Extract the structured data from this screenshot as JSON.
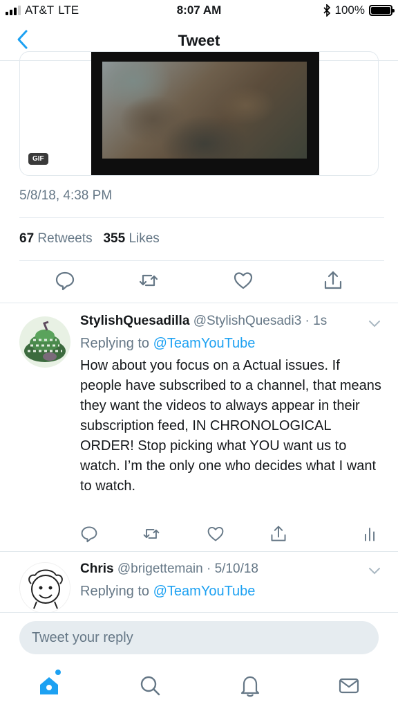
{
  "status_bar": {
    "carrier": "AT&T",
    "network": "LTE",
    "time": "8:07 AM",
    "battery": "100%",
    "battery_level": 1.0
  },
  "nav": {
    "title": "Tweet",
    "back_icon": "chevron-left-icon"
  },
  "tweet": {
    "media_badge": "GIF",
    "timestamp": "5/8/18, 4:38 PM",
    "retweets_count": "67",
    "retweets_label": "Retweets",
    "likes_count": "355",
    "likes_label": "Likes",
    "actions": [
      "reply-icon",
      "retweet-icon",
      "like-icon",
      "share-icon"
    ]
  },
  "replies": [
    {
      "name": "StylishQuesadilla",
      "handle": "@StylishQuesadi3",
      "time": "1s",
      "replying_label": "Replying to",
      "replying_to": "@TeamYouTube",
      "text": "How about you focus on a Actual issues. If people have subscribed to a channel, that means they want the videos to always appear in their subscription feed, IN CHRONOLOGICAL ORDER! Stop picking what YOU want us to watch. I’m the only one who decides what I want to watch.",
      "actions": [
        "reply-icon",
        "retweet-icon",
        "like-icon",
        "share-icon",
        "analytics-icon"
      ]
    },
    {
      "name": "Chris",
      "handle": "@brigettemain",
      "time": "5/10/18",
      "replying_label": "Replying to",
      "replying_to": "@TeamYouTube",
      "text": ""
    }
  ],
  "compose": {
    "placeholder": "Tweet your reply"
  },
  "tabbar": [
    "home-icon",
    "search-icon",
    "notifications-icon",
    "messages-icon"
  ],
  "colors": {
    "accent": "#1da1f2",
    "secondary_text": "#657786",
    "divider": "#e1e8ed"
  }
}
